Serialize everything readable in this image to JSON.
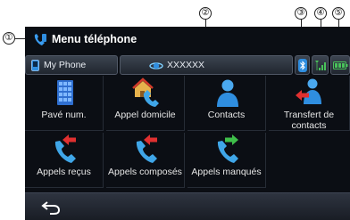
{
  "callouts": [
    "①",
    "②",
    "③",
    "④",
    "⑤"
  ],
  "title": "Menu téléphone",
  "status": {
    "phone_name": "My Phone",
    "operator": "XXXXXX"
  },
  "tiles": [
    {
      "label": "Pavé num.",
      "icon": "keypad-icon"
    },
    {
      "label": "Appel domicile",
      "icon": "home-call-icon"
    },
    {
      "label": "Contacts",
      "icon": "contacts-icon"
    },
    {
      "label": "Transfert de contacts",
      "icon": "transfer-contacts-icon"
    },
    {
      "label": "Appels reçus",
      "icon": "received-calls-icon"
    },
    {
      "label": "Appels composés",
      "icon": "dialed-calls-icon"
    },
    {
      "label": "Appels manqués",
      "icon": "missed-calls-icon"
    }
  ],
  "colors": {
    "background": "#0b0e14",
    "accent_blue": "#2f8ee0",
    "arrow_red": "#e03030",
    "arrow_green": "#3fbf4a"
  }
}
